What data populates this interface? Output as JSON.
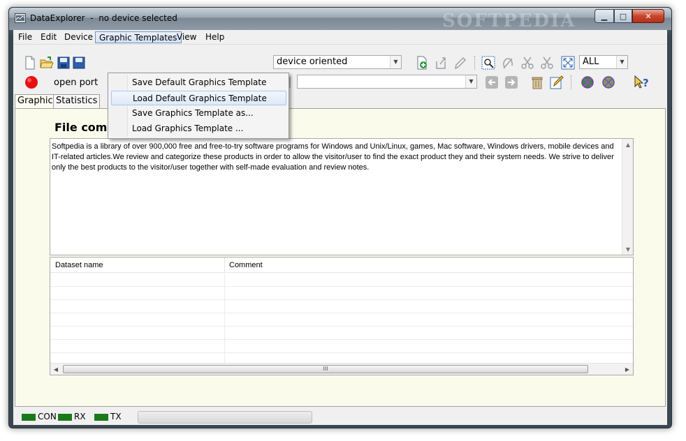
{
  "window": {
    "title": "DataExplorer  -  no device selected",
    "watermark": "SOFTPEDIA",
    "controls": {
      "minimize": "▁",
      "maximize": "□",
      "close": "✕"
    }
  },
  "menubar": {
    "items": [
      "File",
      "Edit",
      "Device",
      "Graphic Templates",
      "View",
      "Help"
    ],
    "active": "Graphic Templates"
  },
  "graphic_templates_menu": {
    "items": [
      "Save Default Graphics Template",
      "Load Default Graphics Template",
      "Save Graphics Template as...",
      "Load Graphics Template ..."
    ],
    "hovered_index": 1
  },
  "toolbar": {
    "device_combo_value": "device oriented",
    "filter_combo_value": "ALL",
    "port_label": "open port",
    "second_combo_value": ""
  },
  "tabs": [
    "Graphic",
    "Statistics"
  ],
  "content": {
    "file_comment_label": "File comment",
    "comment_text": "Softpedia is a library of over 900,000 free and free-to-try software programs for Windows and Unix/Linux, games, Mac software, Windows drivers, mobile devices and IT-related articles.We review and categorize these products in order to allow the visitor/user to find the exact product they and their system needs. We strive to deliver only the best products to the visitor/user together with self-made evaluation and review notes.",
    "table": {
      "columns": [
        "Dataset name",
        "Comment"
      ],
      "scroll_thumb_grip": "III"
    }
  },
  "statusbar": {
    "indicators": [
      "CON",
      "RX",
      "TX"
    ],
    "indicator_color": "#1a7a1a"
  },
  "icons": {
    "new": "new-file-icon",
    "open": "open-folder-icon",
    "save": "save-disk-icon",
    "record": "record-red-icon"
  }
}
